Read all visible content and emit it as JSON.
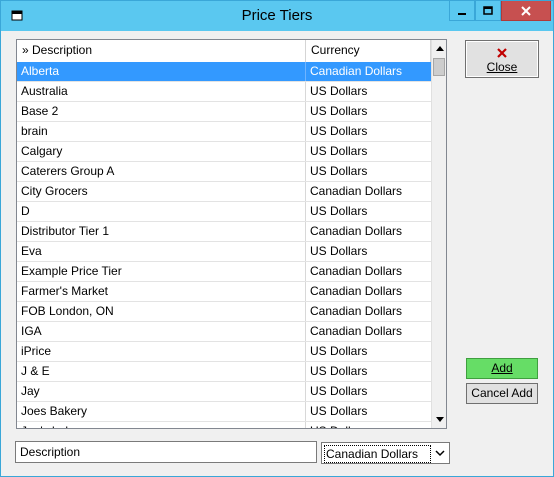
{
  "window": {
    "title": "Price Tiers"
  },
  "list": {
    "columns": {
      "description": "» Description",
      "currency": "Currency"
    },
    "rows": [
      {
        "description": "Alberta",
        "currency": "Canadian Dollars",
        "selected": true
      },
      {
        "description": "Australia",
        "currency": "US Dollars"
      },
      {
        "description": "Base 2",
        "currency": "US Dollars"
      },
      {
        "description": "brain",
        "currency": "US Dollars"
      },
      {
        "description": "Calgary",
        "currency": "US Dollars"
      },
      {
        "description": "Caterers Group A",
        "currency": "US Dollars"
      },
      {
        "description": "City Grocers",
        "currency": "Canadian Dollars"
      },
      {
        "description": "D",
        "currency": "US Dollars"
      },
      {
        "description": "Distributor Tier 1",
        "currency": "Canadian Dollars"
      },
      {
        "description": "Eva",
        "currency": "US Dollars"
      },
      {
        "description": "Example Price Tier",
        "currency": "Canadian Dollars"
      },
      {
        "description": "Farmer's Market",
        "currency": "Canadian Dollars"
      },
      {
        "description": "FOB London, ON",
        "currency": "Canadian Dollars"
      },
      {
        "description": "IGA",
        "currency": "Canadian Dollars"
      },
      {
        "description": "iPrice",
        "currency": "US Dollars"
      },
      {
        "description": "J & E",
        "currency": "US Dollars"
      },
      {
        "description": "Jay",
        "currency": "US Dollars"
      },
      {
        "description": "Joes Bakery",
        "currency": "US Dollars"
      },
      {
        "description": "Joe's bakery",
        "currency": "US Dollars"
      }
    ]
  },
  "buttons": {
    "close": "Close",
    "add": "Add",
    "cancel_add": "Cancel Add"
  },
  "form": {
    "description_value": "Description",
    "currency_selected": "Canadian Dollars"
  },
  "icons": {
    "app": "window-icon",
    "minimize": "minimize-icon",
    "maximize": "maximize-icon",
    "close": "close-icon",
    "close_button": "red-x-icon"
  },
  "colors": {
    "titlebar": "#5ac8f0",
    "selection": "#3399ff",
    "add_button": "#66dd66",
    "close_window": "#c75050"
  }
}
